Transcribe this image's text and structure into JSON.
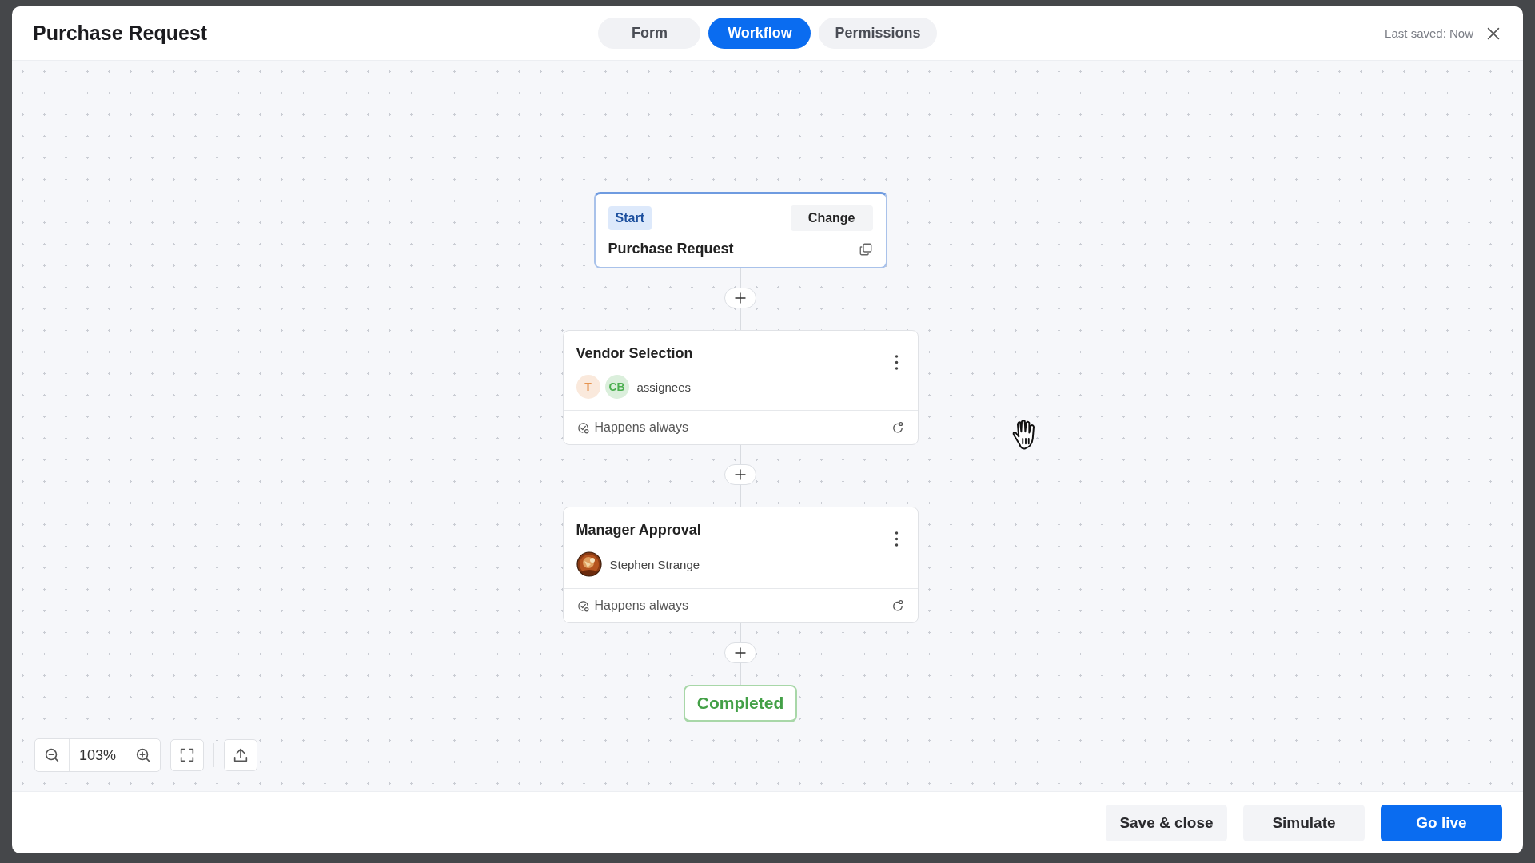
{
  "header": {
    "title": "Purchase Request",
    "tabs": [
      {
        "label": "Form",
        "selected": false
      },
      {
        "label": "Workflow",
        "selected": true
      },
      {
        "label": "Permissions",
        "selected": false
      }
    ],
    "last_saved": "Last saved: Now"
  },
  "workflow": {
    "start": {
      "badge": "Start",
      "change_button": "Change",
      "title": "Purchase Request"
    },
    "steps": [
      {
        "title": "Vendor Selection",
        "kind": "group",
        "avatars": [
          {
            "initials": "T",
            "color": "#e5934f"
          },
          {
            "initials": "CB",
            "color": "#4caf50"
          }
        ],
        "assignee_label": "assignees",
        "condition": "Happens always"
      },
      {
        "title": "Manager Approval",
        "kind": "person",
        "assignee_label": "Stephen Strange",
        "condition": "Happens always"
      }
    ],
    "end": "Completed"
  },
  "zoom": {
    "level": "103%"
  },
  "footer": {
    "buttons": [
      {
        "label": "Save & close",
        "kind": "secondary"
      },
      {
        "label": "Simulate",
        "kind": "secondary"
      },
      {
        "label": "Go live",
        "kind": "primary"
      }
    ]
  }
}
